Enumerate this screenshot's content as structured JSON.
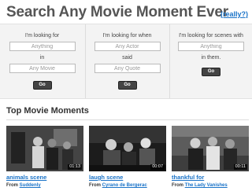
{
  "header": {
    "title": "Search Any Movie Moment Ever",
    "really_link": "(really?)"
  },
  "search": {
    "col1": {
      "label_top": "I'm looking for",
      "input1_placeholder": "Anything",
      "label_mid": "in",
      "input2_placeholder": "Any Movie",
      "button": "Go"
    },
    "col2": {
      "label_top": "I'm looking for when",
      "input1_placeholder": "Any Actor",
      "label_mid": "said",
      "input2_placeholder": "Any Quote",
      "button": "Go"
    },
    "col3": {
      "label_top": "I'm looking for scenes with",
      "input1_placeholder": "Anything",
      "label_mid": "in them.",
      "button": "Go"
    }
  },
  "top_moments": {
    "heading": "Top Movie Moments",
    "from_label": "From",
    "items": [
      {
        "title": "animals scene",
        "film": "Suddenly",
        "duration": "01:13"
      },
      {
        "title": "laugh scene",
        "film": "Cyrano de Bergerac",
        "duration": "00:07"
      },
      {
        "title": "thankful for",
        "film": "The Lady Vanishes",
        "duration": "00:11"
      }
    ]
  },
  "colors": {
    "link": "#1a73c8",
    "title": "#555555",
    "panel_bg": "#f3f3f3",
    "button_bg": "#444444"
  }
}
